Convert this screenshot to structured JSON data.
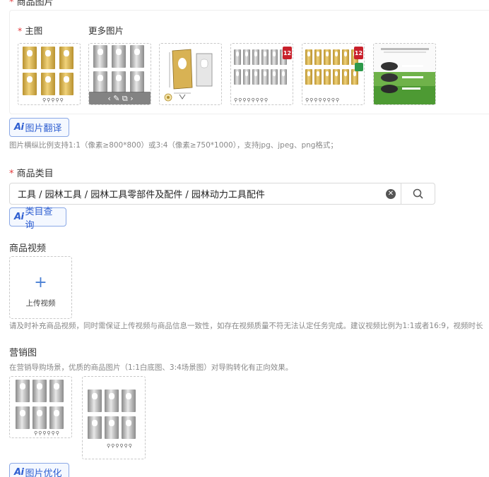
{
  "images_section": {
    "title": "商品图片",
    "main_label": "主图",
    "more_label": "更多图片",
    "translate_btn": "图片翻译",
    "hint": "图片横纵比例支持1:1（像素≥800*800）或3:4（像素≥750*1000），支持jpg、jpeg、png格式；",
    "badge_text": "12",
    "edit_icons": "‹ ✎ ⧉ ›"
  },
  "category_section": {
    "title": "商品类目",
    "value": "工具 / 园林工具 / 园林工具零部件及配件 / 园林动力工具配件",
    "query_btn": "类目查询"
  },
  "video_section": {
    "title": "商品视频",
    "upload_label": "上传视频",
    "hint": "请及时补充商品视频，同时需保证上传视频与商品信息一致性，如存在视频质量不符无法认定任务完成。建议视频比例为1:1或者16:9，视频时长"
  },
  "marketing_section": {
    "title": "营销图",
    "hint": "在营销导购场景，优质的商品图片（1:1白底图、3:4场景图）对导购转化有正向效果。",
    "optimize_btn": "图片优化"
  },
  "ai_label": "Ai",
  "colors": {
    "accent": "#2f5fd1",
    "required": "#e4393c",
    "gold": "#d4b04f",
    "silver": "#b0b0b0"
  }
}
